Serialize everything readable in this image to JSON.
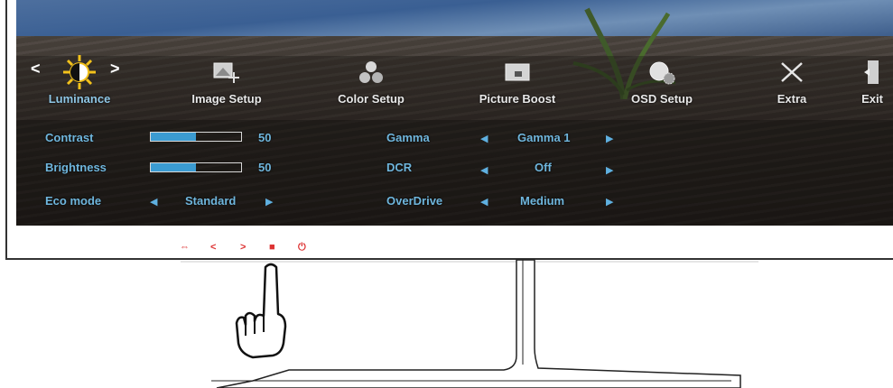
{
  "menu": {
    "items": [
      {
        "label": "Luminance",
        "icon": "sun-contrast-icon",
        "active": true
      },
      {
        "label": "Image Setup",
        "icon": "image-setup-icon"
      },
      {
        "label": "Color Setup",
        "icon": "color-balls-icon"
      },
      {
        "label": "Picture Boost",
        "icon": "picture-boost-icon"
      },
      {
        "label": "OSD Setup",
        "icon": "osd-globe-gear-icon"
      },
      {
        "label": "Extra",
        "icon": "tools-icon"
      },
      {
        "label": "Exit",
        "icon": "exit-door-icon"
      }
    ],
    "nav_left": "<",
    "nav_right": ">"
  },
  "settings": {
    "contrast": {
      "label": "Contrast",
      "value": "50",
      "level": 50
    },
    "brightness": {
      "label": "Brightness",
      "value": "50",
      "level": 50
    },
    "eco_mode": {
      "label": "Eco mode",
      "value": "Standard"
    },
    "gamma": {
      "label": "Gamma",
      "value": "Gamma 1"
    },
    "dcr": {
      "label": "DCR",
      "value": "Off"
    },
    "overdrive": {
      "label": "OverDrive",
      "value": "Medium"
    }
  },
  "bezel": {
    "buttons": [
      "source-icon",
      "left-icon",
      "right-icon",
      "menu-icon",
      "power-icon"
    ],
    "left_glyph": "<",
    "right_glyph": ">"
  },
  "colors": {
    "accent": "#3b9bd1",
    "label_blue": "#6fb6dd",
    "bezel_red": "#dd3333"
  }
}
